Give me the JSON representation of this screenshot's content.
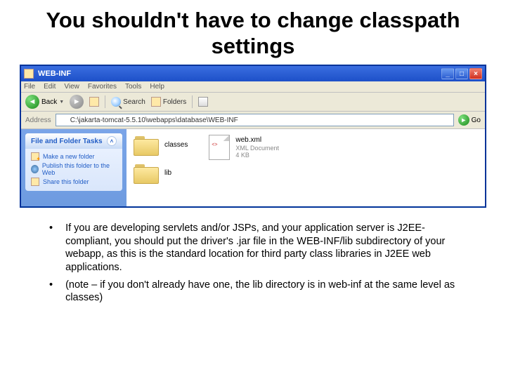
{
  "slide": {
    "title": "You shouldn't have to change classpath settings"
  },
  "explorer": {
    "window_title": "WEB-INF",
    "menu": [
      "File",
      "Edit",
      "View",
      "Favorites",
      "Tools",
      "Help"
    ],
    "toolbar": {
      "back": "Back",
      "search": "Search",
      "folders": "Folders"
    },
    "address": {
      "label": "Address",
      "path": "C:\\jakarta-tomcat-5.5.10\\webapps\\database\\WEB-INF",
      "go": "Go"
    },
    "tasks": {
      "header": "File and Folder Tasks",
      "items": [
        "Make a new folder",
        "Publish this folder to the Web",
        "Share this folder"
      ]
    },
    "files": {
      "classes": "classes",
      "lib": "lib",
      "webxml_name": "web.xml",
      "webxml_type": "XML Document",
      "webxml_size": "4 KB"
    }
  },
  "bullets": {
    "b1": "If you are developing servlets and/or JSPs, and your application server is J2EE-compliant, you should put the driver's .jar file in the WEB-INF/lib subdirectory of your webapp, as this is the standard location for third party class libraries in J2EE web applications.",
    "b2": "(note – if you don't already have one, the lib directory is in web-inf at the same level as classes)"
  }
}
